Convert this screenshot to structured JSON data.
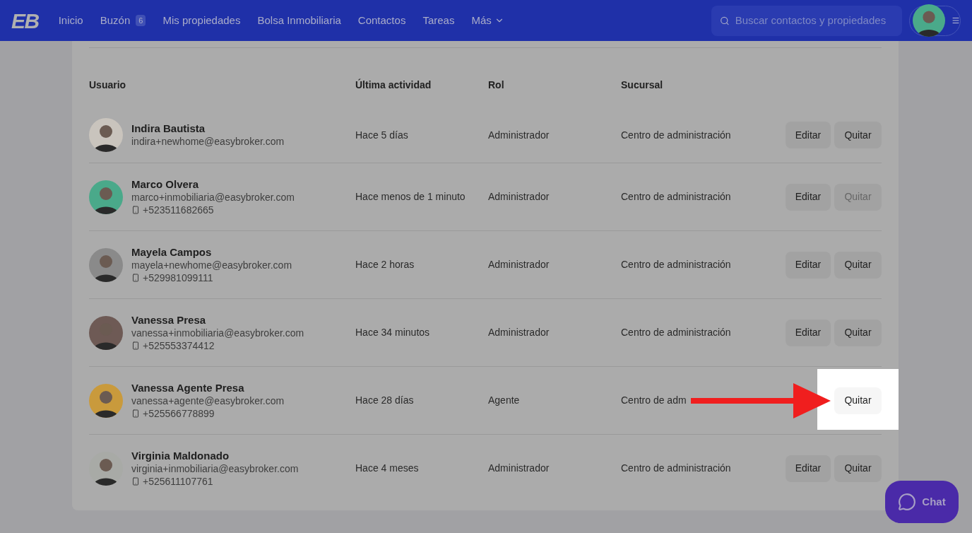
{
  "header": {
    "logo": "EB",
    "nav": [
      {
        "label": "Inicio"
      },
      {
        "label": "Buzón",
        "badge": "6"
      },
      {
        "label": "Mis propiedades"
      },
      {
        "label": "Bolsa Inmobiliaria"
      },
      {
        "label": "Contactos"
      },
      {
        "label": "Tareas"
      },
      {
        "label": "Más",
        "dropdown": true
      }
    ],
    "search": {
      "placeholder": "Buscar contactos y propiedades"
    }
  },
  "table": {
    "columns": [
      "Usuario",
      "Última actividad",
      "Rol",
      "Sucursal"
    ],
    "rows": [
      {
        "name": "Indira Bautista",
        "email": "indira+newhome@easybroker.com",
        "activity": "Hace 5 días",
        "role": "Administrador",
        "branch": "Centro de administración",
        "edit": "Editar",
        "remove": "Quitar",
        "remove_disabled": false,
        "highlighted": false
      },
      {
        "name": "Marco Olvera",
        "email": "marco+inmobiliaria@easybroker.com",
        "phone": "+523511682665",
        "activity": "Hace menos de 1 minuto",
        "role": "Administrador",
        "branch": "Centro de administración",
        "edit": "Editar",
        "remove": "Quitar",
        "remove_disabled": true,
        "highlighted": false
      },
      {
        "name": "Mayela Campos",
        "email": "mayela+newhome@easybroker.com",
        "phone": "+529981099111",
        "activity": "Hace 2 horas",
        "role": "Administrador",
        "branch": "Centro de administración",
        "edit": "Editar",
        "remove": "Quitar",
        "remove_disabled": false,
        "highlighted": false
      },
      {
        "name": "Vanessa Presa",
        "email": "vanessa+inmobiliaria@easybroker.com",
        "phone": "+525553374412",
        "activity": "Hace 34 minutos",
        "role": "Administrador",
        "branch": "Centro de administración",
        "edit": "Editar",
        "remove": "Quitar",
        "remove_disabled": false,
        "highlighted": false
      },
      {
        "name": "Vanessa Agente Presa",
        "email": "vanessa+agente@easybroker.com",
        "phone": "+525566778899",
        "activity": "Hace 28 días",
        "role": "Agente",
        "branch": "Centro de adm",
        "remove": "Quitar",
        "remove_disabled": false,
        "highlighted": true
      },
      {
        "name": "Virginia Maldonado",
        "email": "virginia+inmobiliaria@easybroker.com",
        "phone": "+525611107761",
        "activity": "Hace 4 meses",
        "role": "Administrador",
        "branch": "Centro de administración",
        "edit": "Editar",
        "remove": "Quitar",
        "remove_disabled": false,
        "highlighted": false
      }
    ]
  },
  "chat": {
    "label": "Chat"
  }
}
